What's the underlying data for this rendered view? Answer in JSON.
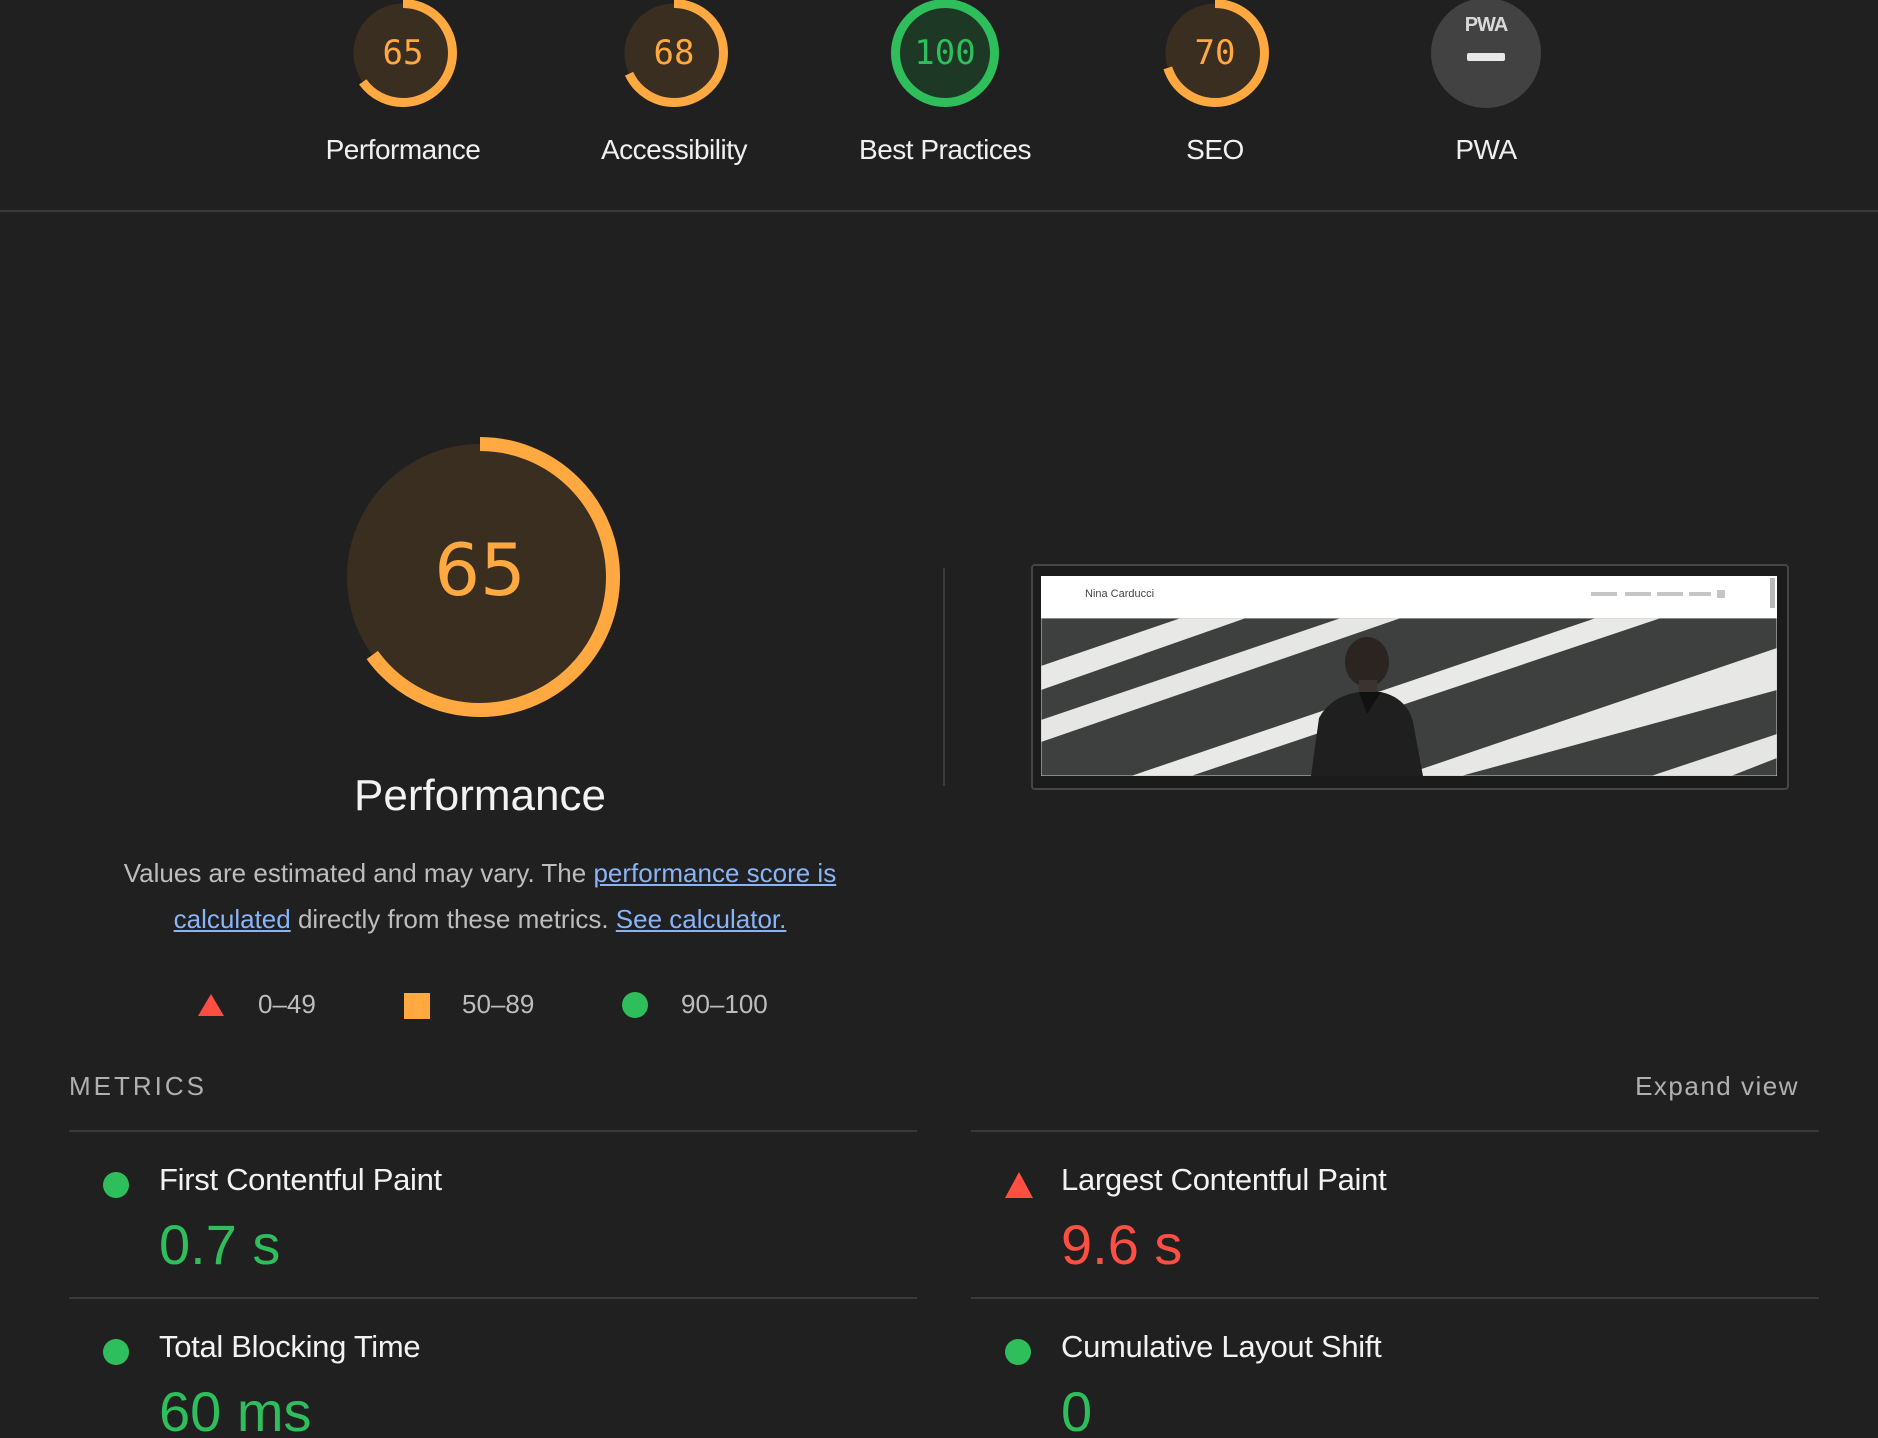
{
  "scores": [
    {
      "id": "performance",
      "label": "Performance",
      "score": "65",
      "value": 65,
      "rating": "average"
    },
    {
      "id": "accessibility",
      "label": "Accessibility",
      "score": "68",
      "value": 68,
      "rating": "average"
    },
    {
      "id": "best-practices",
      "label": "Best Practices",
      "score": "100",
      "value": 100,
      "rating": "pass"
    },
    {
      "id": "seo",
      "label": "SEO",
      "score": "70",
      "value": 70,
      "rating": "average"
    }
  ],
  "pwa": {
    "badge_text": "PWA",
    "label": "PWA"
  },
  "performance": {
    "score": "65",
    "value": 65,
    "title": "Performance",
    "desc_prefix": "Values are estimated and may vary. The ",
    "desc_link1": "performance score is calculated",
    "desc_middle": " directly from these metrics. ",
    "desc_link2": "See calculator."
  },
  "legend": [
    {
      "shape": "triangle",
      "range": "0–49"
    },
    {
      "shape": "square",
      "range": "50–89"
    },
    {
      "shape": "circle",
      "range": "90–100"
    }
  ],
  "screenshot": {
    "site_name": "Nina Carducci"
  },
  "metrics": {
    "header": "METRICS",
    "expand_label": "Expand view",
    "items": [
      {
        "name": "First Contentful Paint",
        "value": "0.7 s",
        "rating": "pass"
      },
      {
        "name": "Largest Contentful Paint",
        "value": "9.6 s",
        "rating": "fail"
      },
      {
        "name": "Total Blocking Time",
        "value": "60 ms",
        "rating": "pass"
      },
      {
        "name": "Cumulative Layout Shift",
        "value": "0",
        "rating": "pass"
      }
    ]
  },
  "colors": {
    "background": "#202020",
    "average": "#ffa940",
    "pass": "#2fbe5c",
    "fail": "#ff4e42",
    "link": "#8ab4f8",
    "average_fill": "#3a2e20",
    "pass_fill": "#1e3826"
  }
}
